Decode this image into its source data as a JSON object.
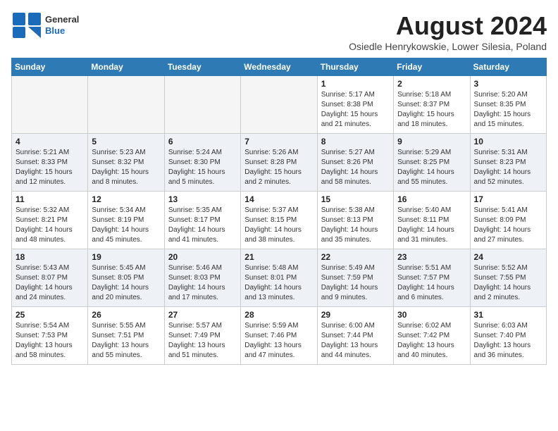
{
  "logo": {
    "general": "General",
    "blue": "Blue"
  },
  "header": {
    "month": "August 2024",
    "location": "Osiedle Henrykowskie, Lower Silesia, Poland"
  },
  "days_of_week": [
    "Sunday",
    "Monday",
    "Tuesday",
    "Wednesday",
    "Thursday",
    "Friday",
    "Saturday"
  ],
  "weeks": [
    [
      {
        "day": "",
        "info": ""
      },
      {
        "day": "",
        "info": ""
      },
      {
        "day": "",
        "info": ""
      },
      {
        "day": "",
        "info": ""
      },
      {
        "day": "1",
        "info": "Sunrise: 5:17 AM\nSunset: 8:38 PM\nDaylight: 15 hours\nand 21 minutes."
      },
      {
        "day": "2",
        "info": "Sunrise: 5:18 AM\nSunset: 8:37 PM\nDaylight: 15 hours\nand 18 minutes."
      },
      {
        "day": "3",
        "info": "Sunrise: 5:20 AM\nSunset: 8:35 PM\nDaylight: 15 hours\nand 15 minutes."
      }
    ],
    [
      {
        "day": "4",
        "info": "Sunrise: 5:21 AM\nSunset: 8:33 PM\nDaylight: 15 hours\nand 12 minutes."
      },
      {
        "day": "5",
        "info": "Sunrise: 5:23 AM\nSunset: 8:32 PM\nDaylight: 15 hours\nand 8 minutes."
      },
      {
        "day": "6",
        "info": "Sunrise: 5:24 AM\nSunset: 8:30 PM\nDaylight: 15 hours\nand 5 minutes."
      },
      {
        "day": "7",
        "info": "Sunrise: 5:26 AM\nSunset: 8:28 PM\nDaylight: 15 hours\nand 2 minutes."
      },
      {
        "day": "8",
        "info": "Sunrise: 5:27 AM\nSunset: 8:26 PM\nDaylight: 14 hours\nand 58 minutes."
      },
      {
        "day": "9",
        "info": "Sunrise: 5:29 AM\nSunset: 8:25 PM\nDaylight: 14 hours\nand 55 minutes."
      },
      {
        "day": "10",
        "info": "Sunrise: 5:31 AM\nSunset: 8:23 PM\nDaylight: 14 hours\nand 52 minutes."
      }
    ],
    [
      {
        "day": "11",
        "info": "Sunrise: 5:32 AM\nSunset: 8:21 PM\nDaylight: 14 hours\nand 48 minutes."
      },
      {
        "day": "12",
        "info": "Sunrise: 5:34 AM\nSunset: 8:19 PM\nDaylight: 14 hours\nand 45 minutes."
      },
      {
        "day": "13",
        "info": "Sunrise: 5:35 AM\nSunset: 8:17 PM\nDaylight: 14 hours\nand 41 minutes."
      },
      {
        "day": "14",
        "info": "Sunrise: 5:37 AM\nSunset: 8:15 PM\nDaylight: 14 hours\nand 38 minutes."
      },
      {
        "day": "15",
        "info": "Sunrise: 5:38 AM\nSunset: 8:13 PM\nDaylight: 14 hours\nand 35 minutes."
      },
      {
        "day": "16",
        "info": "Sunrise: 5:40 AM\nSunset: 8:11 PM\nDaylight: 14 hours\nand 31 minutes."
      },
      {
        "day": "17",
        "info": "Sunrise: 5:41 AM\nSunset: 8:09 PM\nDaylight: 14 hours\nand 27 minutes."
      }
    ],
    [
      {
        "day": "18",
        "info": "Sunrise: 5:43 AM\nSunset: 8:07 PM\nDaylight: 14 hours\nand 24 minutes."
      },
      {
        "day": "19",
        "info": "Sunrise: 5:45 AM\nSunset: 8:05 PM\nDaylight: 14 hours\nand 20 minutes."
      },
      {
        "day": "20",
        "info": "Sunrise: 5:46 AM\nSunset: 8:03 PM\nDaylight: 14 hours\nand 17 minutes."
      },
      {
        "day": "21",
        "info": "Sunrise: 5:48 AM\nSunset: 8:01 PM\nDaylight: 14 hours\nand 13 minutes."
      },
      {
        "day": "22",
        "info": "Sunrise: 5:49 AM\nSunset: 7:59 PM\nDaylight: 14 hours\nand 9 minutes."
      },
      {
        "day": "23",
        "info": "Sunrise: 5:51 AM\nSunset: 7:57 PM\nDaylight: 14 hours\nand 6 minutes."
      },
      {
        "day": "24",
        "info": "Sunrise: 5:52 AM\nSunset: 7:55 PM\nDaylight: 14 hours\nand 2 minutes."
      }
    ],
    [
      {
        "day": "25",
        "info": "Sunrise: 5:54 AM\nSunset: 7:53 PM\nDaylight: 13 hours\nand 58 minutes."
      },
      {
        "day": "26",
        "info": "Sunrise: 5:55 AM\nSunset: 7:51 PM\nDaylight: 13 hours\nand 55 minutes."
      },
      {
        "day": "27",
        "info": "Sunrise: 5:57 AM\nSunset: 7:49 PM\nDaylight: 13 hours\nand 51 minutes."
      },
      {
        "day": "28",
        "info": "Sunrise: 5:59 AM\nSunset: 7:46 PM\nDaylight: 13 hours\nand 47 minutes."
      },
      {
        "day": "29",
        "info": "Sunrise: 6:00 AM\nSunset: 7:44 PM\nDaylight: 13 hours\nand 44 minutes."
      },
      {
        "day": "30",
        "info": "Sunrise: 6:02 AM\nSunset: 7:42 PM\nDaylight: 13 hours\nand 40 minutes."
      },
      {
        "day": "31",
        "info": "Sunrise: 6:03 AM\nSunset: 7:40 PM\nDaylight: 13 hours\nand 36 minutes."
      }
    ]
  ]
}
